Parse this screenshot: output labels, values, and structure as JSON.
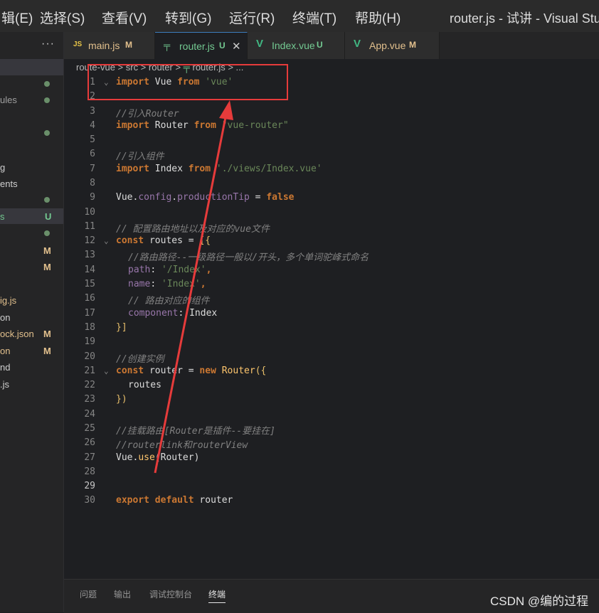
{
  "menubar": {
    "items": [
      "辑(E)",
      "选择(S)",
      "查看(V)",
      "转到(G)",
      "运行(R)",
      "终端(T)",
      "帮助(H)"
    ],
    "window_title": "router.js - 试讲 - Visual Stu"
  },
  "sidebar": {
    "more": "···",
    "items": [
      {
        "label": "ules",
        "color": "#9f9f9f"
      },
      {
        "label": "g",
        "color": "#cfcfcf"
      },
      {
        "label": "ents",
        "color": "#cfcfcf"
      },
      {
        "label": "s",
        "color": "#73c991"
      },
      {
        "label": "ig.js",
        "color": "#e2c08d"
      },
      {
        "label": "on",
        "color": "#cfcfcf"
      },
      {
        "label": "ock.json",
        "color": "#e2c08d"
      },
      {
        "label": "on",
        "color": "#e2c08d"
      },
      {
        "label": "nd",
        "color": "#cfcfcf"
      },
      {
        "label": ".js",
        "color": "#cfcfcf"
      }
    ],
    "badges": {
      "u": "U",
      "m1": "M",
      "m2": "M",
      "m3": "M",
      "m4": "M"
    }
  },
  "tabs": [
    {
      "icon": "JS",
      "label": "main.js",
      "status": "M",
      "color": "#e2c08d"
    },
    {
      "icon": "╤",
      "label": "router.js",
      "status": "U",
      "color": "#73c991",
      "close": "✕"
    },
    {
      "icon": "V",
      "label": "Index.vue",
      "status": "U",
      "color": "#73c991"
    },
    {
      "icon": "V",
      "label": "App.vue",
      "status": "M",
      "color": "#e2c08d"
    }
  ],
  "breadcrumb": {
    "path": "route-vue > src > router > ",
    "file": "router.js",
    "more": " > ..."
  },
  "code_lines": [
    "1",
    "2",
    "3",
    "4",
    "5",
    "6",
    "7",
    "8",
    "9",
    "10",
    "11",
    "12",
    "13",
    "14",
    "15",
    "16",
    "17",
    "18",
    "19",
    "20",
    "21",
    "22",
    "23",
    "24",
    "25",
    "26",
    "27",
    "28",
    "29",
    "30"
  ],
  "code": {
    "l1a": "import",
    "l1b": " Vue ",
    "l1c": "from",
    "l1d": " 'vue'",
    "l3": "//引入Router",
    "l4a": "import",
    "l4b": " Router ",
    "l4c": "from",
    "l4d": " \"vue-router\"",
    "l6": "//引入组件",
    "l7a": "import",
    "l7b": " Index ",
    "l7c": "from",
    "l7d": " './views/Index.vue'",
    "l9a": "Vue.",
    "l9b": "config",
    "l9c": ".",
    "l9d": "productionTip",
    "l9e": " = ",
    "l9f": "false",
    "l11": "// 配置路由地址以及对应的vue文件",
    "l12a": "const",
    "l12b": " routes = ",
    "l12c": "[{",
    "l13": "//路由路径--一级路径一般以/开头，多个单词驼峰式命名",
    "l14a": "path",
    "l14b": ": ",
    "l14c": "'/Index'",
    "l14d": ",",
    "l15a": "name",
    "l15b": ": ",
    "l15c": "'Index'",
    "l15d": ",",
    "l16": "// 路由对应的组件",
    "l17a": "component",
    "l17b": ": Index",
    "l18": "}]",
    "l20": "//创建实例",
    "l21a": "const",
    "l21b": " router = ",
    "l21c": "new",
    "l21d": " ",
    "l21e": "Router",
    "l21f": "({",
    "l22": "routes",
    "l23": "})",
    "l25": "//挂载路由[Router是插件--要挂在]",
    "l26": "//routerlink和routerView",
    "l27a": "Vue.",
    "l27b": "use",
    "l27c": "(Router)",
    "l30a": "export",
    "l30b": " ",
    "l30c": "default",
    "l30d": " router"
  },
  "panel": {
    "tabs": [
      "问题",
      "输出",
      "调试控制台",
      "终端"
    ],
    "active": "终端"
  },
  "watermark": "CSDN @编的过程",
  "colors": {
    "annotation": "#e63b3b",
    "keyword": "#cc7832",
    "string": "#6a8759",
    "comment": "#808080"
  }
}
